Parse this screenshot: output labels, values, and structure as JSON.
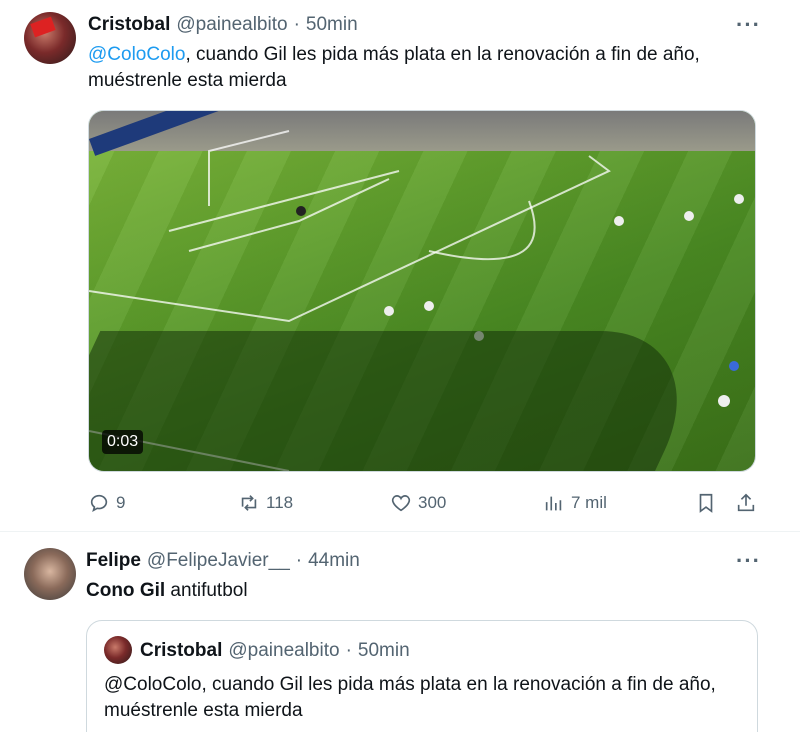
{
  "tweet1": {
    "name": "Cristobal",
    "handle": "@painealbito",
    "dot": "·",
    "time": "50min",
    "more": "···",
    "mention": "@ColoColo",
    "text_line1_rest": ", cuando Gil les pida más plata en la renovación a fin de año,",
    "text_line2": "muéstrenle esta mierda",
    "video_timecode": "0:03",
    "actions": {
      "replies": "9",
      "reposts": "118",
      "likes": "300",
      "views": "7 mil"
    }
  },
  "tweet2": {
    "name": "Felipe",
    "handle": "@FelipeJavier__",
    "dot": "·",
    "time": "44min",
    "more": "···",
    "text_bold": "Cono Gil",
    "text_rest": " antifutbol",
    "quote": {
      "name": "Cristobal",
      "handle": "@painealbito",
      "dot": "·",
      "time": "50min",
      "line1": "@ColoColo, cuando Gil les pida más plata en la renovación a fin de año,",
      "line2": "muéstrenle esta mierda"
    }
  },
  "icons": [
    "reply-icon",
    "repost-icon",
    "like-icon",
    "views-icon",
    "bookmark-icon",
    "share-icon",
    "more-icon"
  ],
  "colors": {
    "link": "#1d9bf0",
    "secondary": "#536471",
    "primary": "#0f1419",
    "border": "#cfd9de"
  }
}
